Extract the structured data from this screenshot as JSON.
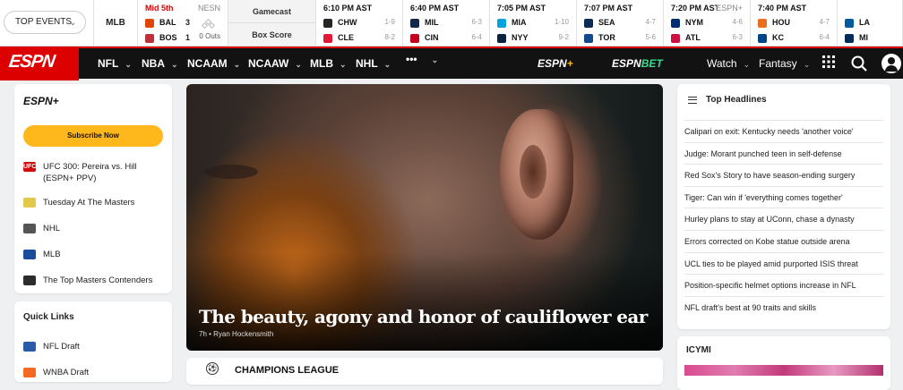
{
  "scoreboard": {
    "top_events_label": "TOP EVENTS",
    "league": "MLB",
    "live_game": {
      "status": "Mid 5th",
      "network": "NESN",
      "teams": [
        {
          "abbr": "BAL",
          "score": "3",
          "color": "#df4601"
        },
        {
          "abbr": "BOS",
          "score": "1",
          "color": "#bd3039"
        }
      ],
      "outs": "0 Outs"
    },
    "gamecast_label": "Gamecast",
    "boxscore_label": "Box Score",
    "games": [
      {
        "time": "6:10 PM AST",
        "network": "",
        "teams": [
          {
            "abbr": "CHW",
            "record": "1-9",
            "color": "#27251f"
          },
          {
            "abbr": "CLE",
            "record": "8-2",
            "color": "#e31937"
          }
        ]
      },
      {
        "time": "6:40 PM AST",
        "network": "",
        "teams": [
          {
            "abbr": "MIL",
            "record": "6-3",
            "color": "#12284b"
          },
          {
            "abbr": "CIN",
            "record": "6-4",
            "color": "#c6011f"
          }
        ]
      },
      {
        "time": "7:05 PM AST",
        "network": "",
        "teams": [
          {
            "abbr": "MIA",
            "record": "1-10",
            "color": "#00a3e0"
          },
          {
            "abbr": "NYY",
            "record": "9-2",
            "color": "#0c2340"
          }
        ]
      },
      {
        "time": "7:07 PM AST",
        "network": "",
        "teams": [
          {
            "abbr": "SEA",
            "record": "4-7",
            "color": "#0c2c56"
          },
          {
            "abbr": "TOR",
            "record": "5-6",
            "color": "#134a8e"
          }
        ]
      },
      {
        "time": "7:20 PM AST",
        "network": "ESPN+",
        "teams": [
          {
            "abbr": "NYM",
            "record": "4-6",
            "color": "#002d72"
          },
          {
            "abbr": "ATL",
            "record": "6-3",
            "color": "#ce1141"
          }
        ]
      },
      {
        "time": "7:40 PM AST",
        "network": "",
        "teams": [
          {
            "abbr": "HOU",
            "record": "4-7",
            "color": "#eb6e1f"
          },
          {
            "abbr": "KC",
            "record": "6-4",
            "color": "#004687"
          }
        ]
      },
      {
        "time": "",
        "network": "",
        "teams": [
          {
            "abbr": "LA",
            "record": "",
            "color": "#005a9c"
          },
          {
            "abbr": "MI",
            "record": "",
            "color": "#002b5c"
          }
        ]
      }
    ]
  },
  "nav": {
    "logo": "ESPN",
    "items": [
      "NFL",
      "NBA",
      "NCAAM",
      "NCAAW",
      "MLB",
      "NHL",
      "•••"
    ],
    "espnplus_brand": "ESPN",
    "espnplus_plus": "+",
    "espnbet_brand": "ESPN",
    "espnbet_bet": "BET",
    "watch": "Watch",
    "fantasy": "Fantasy"
  },
  "left": {
    "brand": "ESPN+",
    "subscribe_label": "Subscribe Now",
    "links": [
      {
        "icon": "ufc-icon",
        "badge": "UFC",
        "color": "#d20a0a",
        "label": "UFC 300: Pereira vs. Hill (ESPN+ PPV)"
      },
      {
        "icon": "masters-icon",
        "badge": "",
        "color": "#e2c94a",
        "label": "Tuesday At The Masters"
      },
      {
        "icon": "nhl-icon",
        "badge": "",
        "color": "#555555",
        "label": "NHL"
      },
      {
        "icon": "mlb-icon",
        "badge": "",
        "color": "#1a4c9c",
        "label": "MLB"
      },
      {
        "icon": "masters-board-icon",
        "badge": "",
        "color": "#2c2c2c",
        "label": "The Top Masters Contenders"
      }
    ],
    "quick_links_title": "Quick Links",
    "quick_links": [
      {
        "icon": "nfl-draft-icon",
        "color": "#2a5ba8",
        "label": "NFL Draft"
      },
      {
        "icon": "wnba-draft-icon",
        "color": "#f36a21",
        "label": "WNBA Draft"
      }
    ]
  },
  "hero": {
    "title": "The beauty, agony and honor of cauliflower ear",
    "meta": "7h • Ryan Hockensmith"
  },
  "next_card": {
    "title": "CHAMPIONS LEAGUE"
  },
  "headlines": {
    "title": "Top Headlines",
    "items": [
      "Calipari on exit: Kentucky needs 'another voice'",
      "Judge: Morant punched teen in self-defense",
      "Red Sox's Story to have season-ending surgery",
      "Tiger: Can win if 'everything comes together'",
      "Hurley plans to stay at UConn, chase a dynasty",
      "Errors corrected on Kobe statue outside arena",
      "UCL ties to be played amid purported ISIS threat",
      "Position-specific helmet options increase in NFL",
      "NFL draft's best at 90 traits and skills"
    ]
  },
  "icymi": {
    "title": "ICYMI"
  }
}
